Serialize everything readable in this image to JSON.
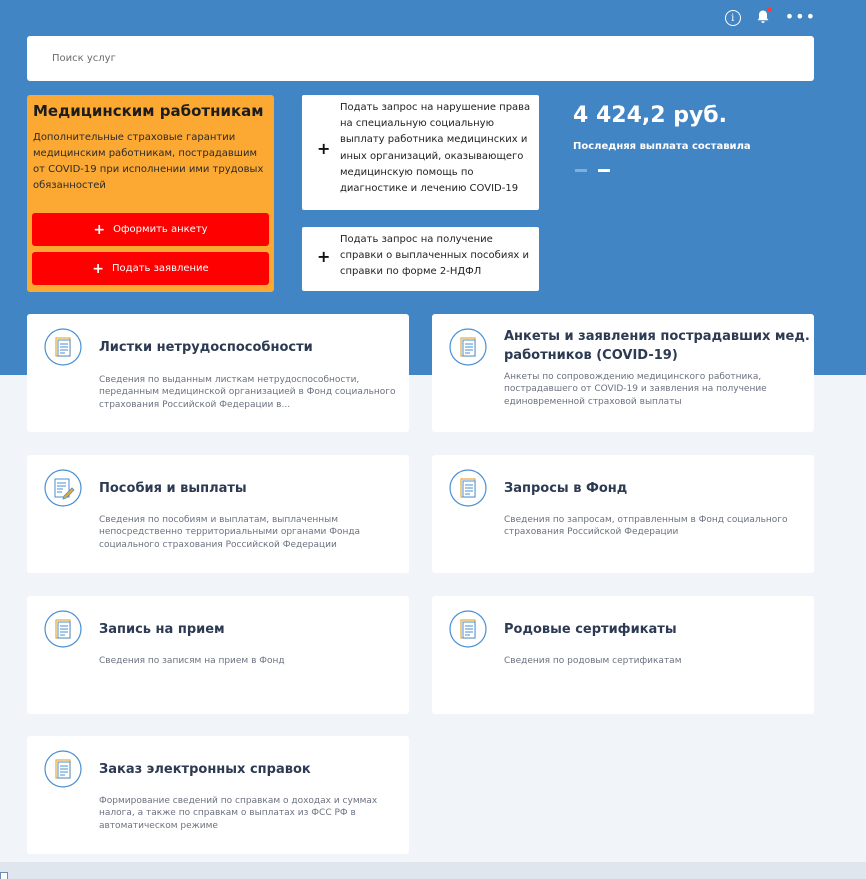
{
  "search": {
    "placeholder": "Поиск услуг"
  },
  "med_card": {
    "title": "Медицинским работникам",
    "text": "Дополнительные страховые гарантии медицинским работникам, пострадавшим от COVID-19 при исполнении ими трудовых обязанностей",
    "buttons": [
      {
        "label": "Оформить анкету"
      },
      {
        "label": "Подать заявление"
      }
    ],
    "color": "#fca934",
    "button_color": "#fe0000"
  },
  "requests": [
    {
      "label": "Подать запрос на нарушение права на специальную социальную выплату работника медицинских и иных организаций, оказывающего медицинскую помощь по диагностике и лечению COVID-19"
    },
    {
      "label": "Подать запрос на получение справки о выплаченных пособиях и справки по форме 2-НДФЛ"
    }
  ],
  "payment": {
    "amount": "4 424,2 руб.",
    "label": "Последняя выплата составила",
    "pager": {
      "count": 2,
      "active": 2
    }
  },
  "icons": {
    "info": "i",
    "more": "•••"
  },
  "tiles": [
    {
      "title": "Листки нетрудоспособности",
      "desc": "Сведения по выданным листкам нетрудоспособности, переданным медицинской организацией в Фонд социального страхования Российской Федерации в...",
      "icon": "document-icon"
    },
    {
      "title": "Анкеты и заявления пострадавших мед. работников (COVID-19)",
      "desc": "Анкеты по сопровождению медицинского работника, пострадавшего от COVID-19 и заявления на получение единовременной страховой выплаты",
      "icon": "document-icon"
    },
    {
      "title": "Пособия и выплаты",
      "desc": "Сведения по пособиям и выплатам, выплаченным непосредственно территориальными органами Фонда социального страхования Российской Федерации",
      "icon": "document-pen-icon"
    },
    {
      "title": "Запросы в Фонд",
      "desc": "Сведения по запросам, отправленным в Фонд социального страхования Российской Федерации",
      "icon": "document-icon"
    },
    {
      "title": "Запись на прием",
      "desc": "Сведения по записям на прием в Фонд",
      "icon": "document-icon"
    },
    {
      "title": "Родовые сертификаты",
      "desc": "Сведения по родовым сертификатам",
      "icon": "document-icon"
    },
    {
      "title": "Заказ электронных справок",
      "desc": "Формирование сведений по справкам о доходах и суммах налога, а также по справкам о выплатах из ФСС РФ в автоматическом режиме",
      "icon": "document-icon"
    }
  ],
  "colors": {
    "header_blue": "#4185c5",
    "page_bg": "#f1f5fa",
    "tile_title": "#2c3a52",
    "icon_accent": "#4a8fd1"
  }
}
